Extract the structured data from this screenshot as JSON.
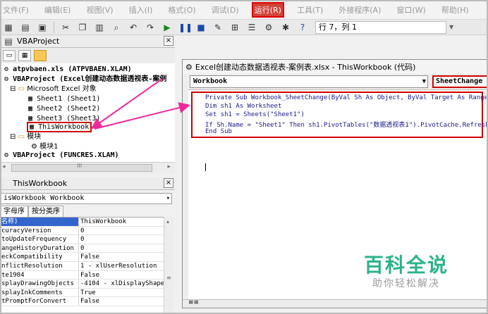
{
  "menubar": {
    "items": [
      "文件(F)",
      "编辑(E)",
      "视图(V)",
      "插入(I)",
      "格式(O)",
      "调试(D)",
      "运行(R)",
      "工具(T)",
      "外接程序(A)",
      "窗口(W)",
      "帮助(H)"
    ],
    "active_index": 6
  },
  "toolbar": {
    "position_text": "行 7，列 1"
  },
  "project": {
    "title": "VBAProject",
    "close": "×",
    "tree": [
      "atpvbaen.xls (ATPVBAEN.XLAM)",
      "VBAProject (Excel创建动态数据透视表-案例",
      "Microsoft Excel 对象",
      "Sheet1 (Sheet1)",
      "Sheet2 (Sheet2)",
      "Sheet3 (Sheet3)",
      "ThisWorkbook",
      "模块",
      "模块1",
      "VBAProject (FUNCRES.XLAM)"
    ],
    "scroll_label": "III"
  },
  "properties": {
    "title": "ThisWorkbook",
    "close": "×",
    "object_select": "isWorkbook Workbook",
    "tabs": [
      "字母序",
      "按分类序"
    ],
    "rows": [
      {
        "k": "名称)",
        "v": "ThisWorkbook"
      },
      {
        "k": "curacyVersion",
        "v": "0"
      },
      {
        "k": "toUpdateFrequency",
        "v": "0"
      },
      {
        "k": "angeHistoryDuration",
        "v": "0"
      },
      {
        "k": "eckCompatibility",
        "v": "False"
      },
      {
        "k": "nflictResolution",
        "v": "1 - xlUserResolution"
      },
      {
        "k": "te1904",
        "v": "False"
      },
      {
        "k": "splayDrawingObjects",
        "v": "-4104 - xlDisplayShape"
      },
      {
        "k": "splayInkComments",
        "v": "True"
      },
      {
        "k": "tPromptForConvert",
        "v": "False"
      }
    ]
  },
  "code_window": {
    "title": "Excel创建动态数据透视表-案例表.xlsx - ThisWorkbook (代码)",
    "object": "Workbook",
    "procedure": "SheetChange",
    "lines": [
      "Private Sub Workbook_SheetChange(ByVal Sh As Object, ByVal Target As Range)",
      "Dim sh1 As Worksheet",
      "Set sh1 = Sheets(\"Sheet1\")",
      "If Sh.Name = \"Sheet1\" Then sh1.PivotTables(\"数据透视表1\").PivotCache.Refresh",
      "End Sub"
    ]
  },
  "watermark": {
    "title": "百科全说",
    "subtitle": "助你轻松解决"
  },
  "colors": {
    "highlight": "#d00000",
    "arrow": "#ee2a9a",
    "watermark": "#2bb389"
  }
}
